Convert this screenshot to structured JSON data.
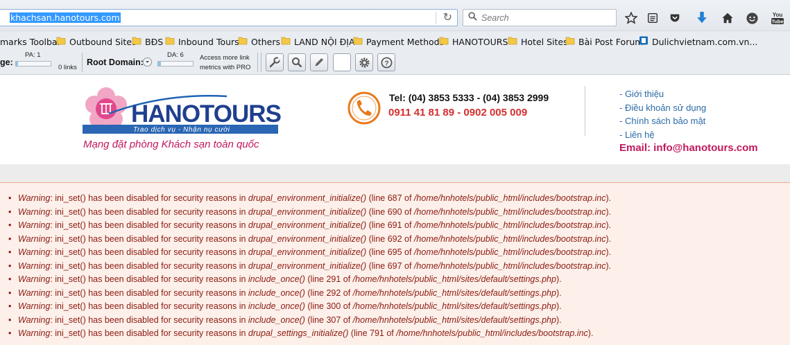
{
  "browser": {
    "url": "khachsan.hanotours.com",
    "search_placeholder": "Search"
  },
  "bookmarks": [
    {
      "label": "marks Toolbar",
      "folder": false
    },
    {
      "label": "Outbound Sites",
      "folder": true
    },
    {
      "label": "BĐS",
      "folder": true
    },
    {
      "label": "Inbound Tours",
      "folder": true
    },
    {
      "label": "Others",
      "folder": true
    },
    {
      "label": "LAND NỘI ĐỊA",
      "folder": true
    },
    {
      "label": "Payment Methods",
      "folder": true
    },
    {
      "label": "HANOTOURS",
      "folder": true
    },
    {
      "label": "Hotel Sites",
      "folder": true
    },
    {
      "label": "Bài Post Forum",
      "folder": true
    },
    {
      "label": "Dulichvietnam.com.vn...",
      "folder": false
    }
  ],
  "mozbar": {
    "page_label": "ge:",
    "pa": "PA: 1",
    "links": "0 links",
    "root_domain_label": "Root Domain:",
    "da": "DA: 6",
    "pro_line1": "Access more link",
    "pro_line2": "metrics with PRO"
  },
  "site": {
    "logo_text": "HANOTOURS",
    "logo_slogan": "Trao dịch vụ - Nhận nụ cười",
    "tagline": "Mạng đặt phòng Khách sạn toàn quốc",
    "tel_line": "Tel: (04) 3853 5333 - (04) 3853 2999",
    "mobile_line": "0911 41 81 89 - 0902 005 009",
    "links": [
      "- Giới thiệu",
      "- Điều khoản sử dụng",
      "- Chính sách bảo mật",
      "- Liên hệ"
    ],
    "email": "Email: info@hanotours.com"
  },
  "warnings": [
    {
      "label": "Warning",
      "text": ": ini_set() has been disabled for security reasons in ",
      "func": "drupal_environment_initialize()",
      "line": " (line 687 of ",
      "path": "/home/hnhotels/public_html/includes/bootstrap.inc",
      "end": ")."
    },
    {
      "label": "Warning",
      "text": ": ini_set() has been disabled for security reasons in ",
      "func": "drupal_environment_initialize()",
      "line": " (line 690 of ",
      "path": "/home/hnhotels/public_html/includes/bootstrap.inc",
      "end": ")."
    },
    {
      "label": "Warning",
      "text": ": ini_set() has been disabled for security reasons in ",
      "func": "drupal_environment_initialize()",
      "line": " (line 691 of ",
      "path": "/home/hnhotels/public_html/includes/bootstrap.inc",
      "end": ")."
    },
    {
      "label": "Warning",
      "text": ": ini_set() has been disabled for security reasons in ",
      "func": "drupal_environment_initialize()",
      "line": " (line 692 of ",
      "path": "/home/hnhotels/public_html/includes/bootstrap.inc",
      "end": ")."
    },
    {
      "label": "Warning",
      "text": ": ini_set() has been disabled for security reasons in ",
      "func": "drupal_environment_initialize()",
      "line": " (line 695 of ",
      "path": "/home/hnhotels/public_html/includes/bootstrap.inc",
      "end": ")."
    },
    {
      "label": "Warning",
      "text": ": ini_set() has been disabled for security reasons in ",
      "func": "drupal_environment_initialize()",
      "line": " (line 697 of ",
      "path": "/home/hnhotels/public_html/includes/bootstrap.inc",
      "end": ")."
    },
    {
      "label": "Warning",
      "text": ": ini_set() has been disabled for security reasons in ",
      "func": "include_once()",
      "line": " (line 291 of ",
      "path": "/home/hnhotels/public_html/sites/default/settings.php",
      "end": ")."
    },
    {
      "label": "Warning",
      "text": ": ini_set() has been disabled for security reasons in ",
      "func": "include_once()",
      "line": " (line 292 of ",
      "path": "/home/hnhotels/public_html/sites/default/settings.php",
      "end": ")."
    },
    {
      "label": "Warning",
      "text": ": ini_set() has been disabled for security reasons in ",
      "func": "include_once()",
      "line": " (line 300 of ",
      "path": "/home/hnhotels/public_html/sites/default/settings.php",
      "end": ")."
    },
    {
      "label": "Warning",
      "text": ": ini_set() has been disabled for security reasons in ",
      "func": "include_once()",
      "line": " (line 307 of ",
      "path": "/home/hnhotels/public_html/sites/default/settings.php",
      "end": ")."
    },
    {
      "label": "Warning",
      "text": ": ini_set() has been disabled for security reasons in ",
      "func": "drupal_settings_initialize()",
      "line": " (line 791 of ",
      "path": "/home/hnhotels/public_html/includes/bootstrap.inc",
      "end": ")."
    }
  ],
  "colors": {
    "warning_text": "#8b1a10",
    "warning_bg": "#fdf0ea",
    "brand_blue": "#1f3f8f",
    "brand_pink": "#c2185b",
    "phone_red": "#d32f2f"
  },
  "icons": [
    "search-icon",
    "reload-icon",
    "star-icon",
    "reading-list-icon",
    "pocket-icon",
    "download-icon",
    "home-icon",
    "chat-icon",
    "youtube-icon",
    "wrench-icon",
    "magnifier-icon",
    "pencil-icon",
    "gear-icon",
    "help-icon",
    "phone-icon"
  ]
}
